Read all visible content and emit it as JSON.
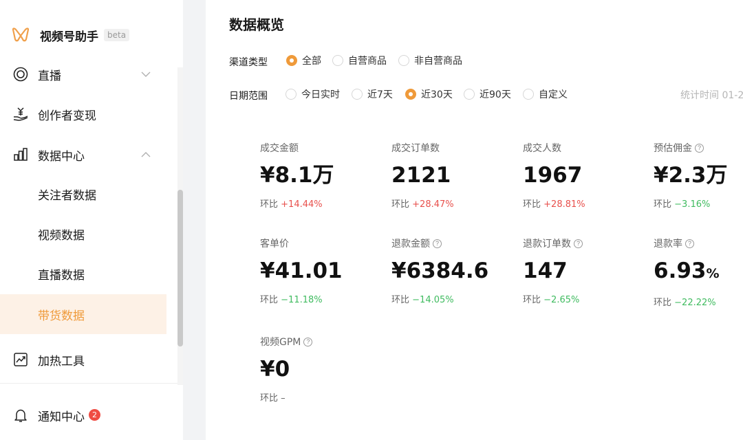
{
  "app": {
    "name": "视频号助手",
    "beta": "beta"
  },
  "sidebar": {
    "items": [
      {
        "label": "直播",
        "icon": "live-ring-icon"
      },
      {
        "label": "创作者变现",
        "icon": "money-hand-icon"
      },
      {
        "label": "数据中心",
        "icon": "bar-chart-icon"
      },
      {
        "label": "关注者数据"
      },
      {
        "label": "视频数据"
      },
      {
        "label": "直播数据"
      },
      {
        "label": "带货数据",
        "active": true
      },
      {
        "label": "加热工具",
        "icon": "trend-chart-icon"
      },
      {
        "label": "通知中心",
        "icon": "bell-icon",
        "badge": "2"
      }
    ]
  },
  "main": {
    "title": "数据概览",
    "channel": {
      "label": "渠道类型",
      "options": [
        "全部",
        "自营商品",
        "非自营商品"
      ],
      "selected": "全部"
    },
    "date": {
      "label": "日期范围",
      "options": [
        "今日实时",
        "近7天",
        "近30天",
        "近90天",
        "自定义"
      ],
      "selected": "近30天"
    },
    "stat_time": "统计时间 01-2",
    "change_prefix": "环比",
    "metrics": [
      {
        "label": "成交金额",
        "value": "¥8.1万",
        "change": "+14.44%",
        "trend": "up",
        "help": false
      },
      {
        "label": "成交订单数",
        "value": "2121",
        "change": "+28.47%",
        "trend": "up",
        "help": false
      },
      {
        "label": "成交人数",
        "value": "1967",
        "change": "+28.81%",
        "trend": "up",
        "help": false
      },
      {
        "label": "预估佣金",
        "value": "¥2.3万",
        "change": "−3.16%",
        "trend": "down",
        "help": true
      },
      {
        "label": "客单价",
        "value": "¥41.01",
        "change": "−11.18%",
        "trend": "down",
        "help": false
      },
      {
        "label": "退款金额",
        "value": "¥6384.6",
        "change": "−14.05%",
        "trend": "down",
        "help": true
      },
      {
        "label": "退款订单数",
        "value": "147",
        "change": "−2.65%",
        "trend": "down",
        "help": true
      },
      {
        "label": "退款率",
        "value": "6.93",
        "unit": "%",
        "change": "−22.22%",
        "trend": "down",
        "help": true
      },
      {
        "label": "视频GPM",
        "value": "¥0",
        "change": "–",
        "trend": "none",
        "help": true
      }
    ]
  },
  "colors": {
    "accent": "#ef9a3a",
    "up": "#e8504c",
    "down": "#3fbb5f",
    "badge": "#ef4c43"
  }
}
